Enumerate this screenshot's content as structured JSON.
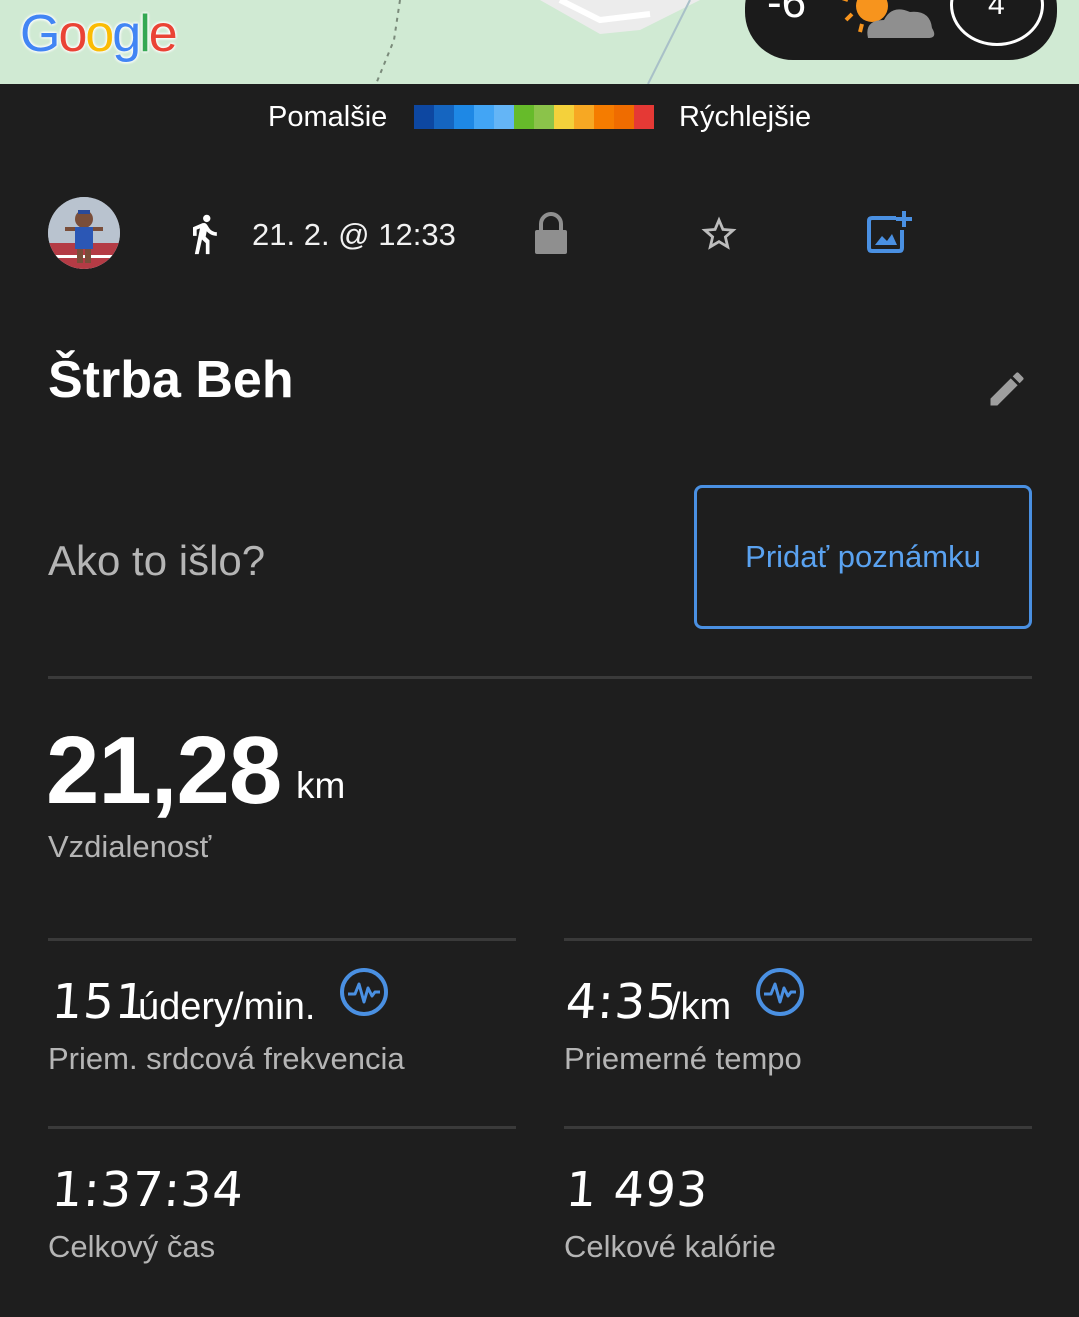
{
  "map": {
    "logo": "Google",
    "weather": {
      "temperature": "-6",
      "icon": "partly-cloudy-icon",
      "wind": "4"
    }
  },
  "legend": {
    "slow_label": "Pomalšie",
    "fast_label": "Rýchlejšie",
    "colors": [
      "#0d47a1",
      "#1565c0",
      "#1e88e5",
      "#42a5f5",
      "#64b5f6",
      "#66bb2a",
      "#8bc34a",
      "#f4d13b",
      "#f7a823",
      "#f57c00",
      "#ef6c00",
      "#e53935"
    ]
  },
  "activity": {
    "type_icon": "running-icon",
    "date": "21. 2. @ 12:33",
    "privacy_icon": "lock-icon",
    "favorite_icon": "star-outline-icon",
    "add_photo_icon": "add-photo-icon",
    "title": "Štrba Beh",
    "edit_icon": "pencil-icon"
  },
  "note": {
    "prompt": "Ako to išlo?",
    "button_label": "Pridať poznámku"
  },
  "distance": {
    "value": "21,28",
    "unit": "km",
    "label": "Vzdialenosť"
  },
  "stats": [
    {
      "value": "151",
      "unit": "údery/min.",
      "label": "Priem. srdcová frekvencia",
      "icon": "heart-rate-graph-icon"
    },
    {
      "value": "4:35",
      "unit": "/km",
      "label": "Priemerné tempo",
      "icon": "pace-graph-icon"
    },
    {
      "value": "1:37:34",
      "unit": "",
      "label": "Celkový čas"
    },
    {
      "value": "1 493",
      "unit": "",
      "label": "Celkové kalórie"
    }
  ],
  "colors": {
    "background": "#1e1e1e",
    "accent_blue": "#4a90e2",
    "secondary_text": "#b5b5b5",
    "divider": "#3a3a3a"
  }
}
